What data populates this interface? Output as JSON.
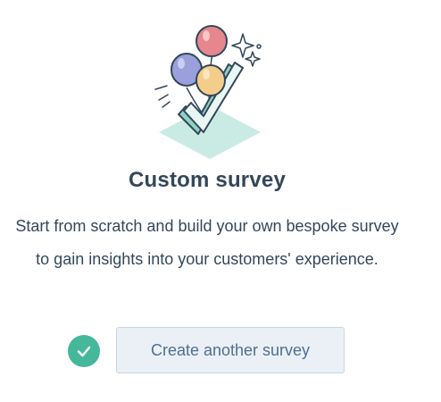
{
  "card": {
    "illustration_icon": "balloons-checkmark-icon",
    "title": "Custom survey",
    "description": "Start from scratch and build your own bespoke survey to gain insights into your customers' experience."
  },
  "status": {
    "icon": "check-circle-icon",
    "color": "#45b79b"
  },
  "actions": {
    "create_label": "Create another survey"
  }
}
